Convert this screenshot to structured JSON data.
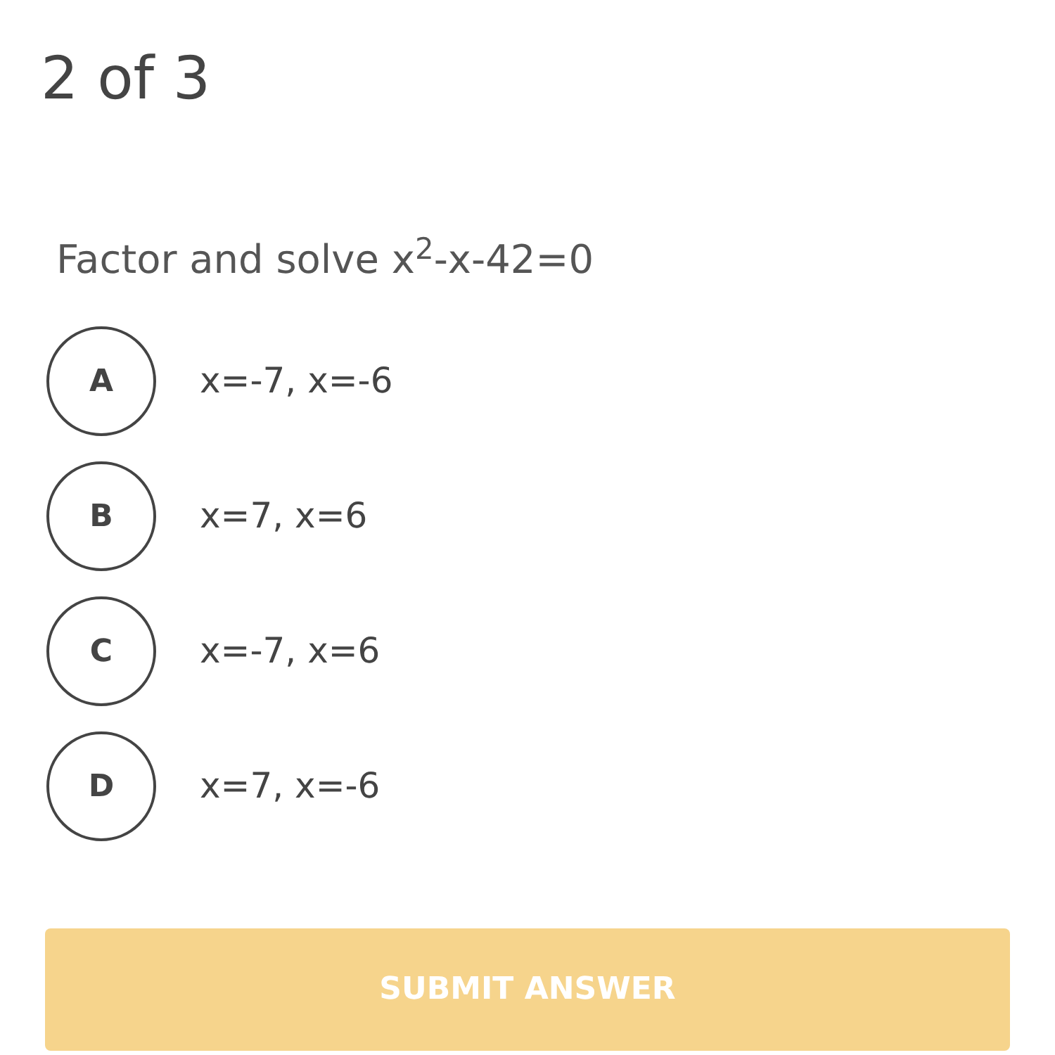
{
  "progress": "2 of 3",
  "question": "Factor and solve x$^{2}$-x-42=0",
  "options": [
    {
      "letter": "A",
      "text": "x=-7, x=-6",
      "selected": false
    },
    {
      "letter": "B",
      "text": "x=7, x=6",
      "selected": false
    },
    {
      "letter": "C",
      "text": "x=-7, x=6",
      "selected": false
    },
    {
      "letter": "D",
      "text": "x=7, x=-6",
      "selected": false
    }
  ],
  "submit_button": {
    "label": "SUBMIT ANSWER",
    "disabled": true
  }
}
